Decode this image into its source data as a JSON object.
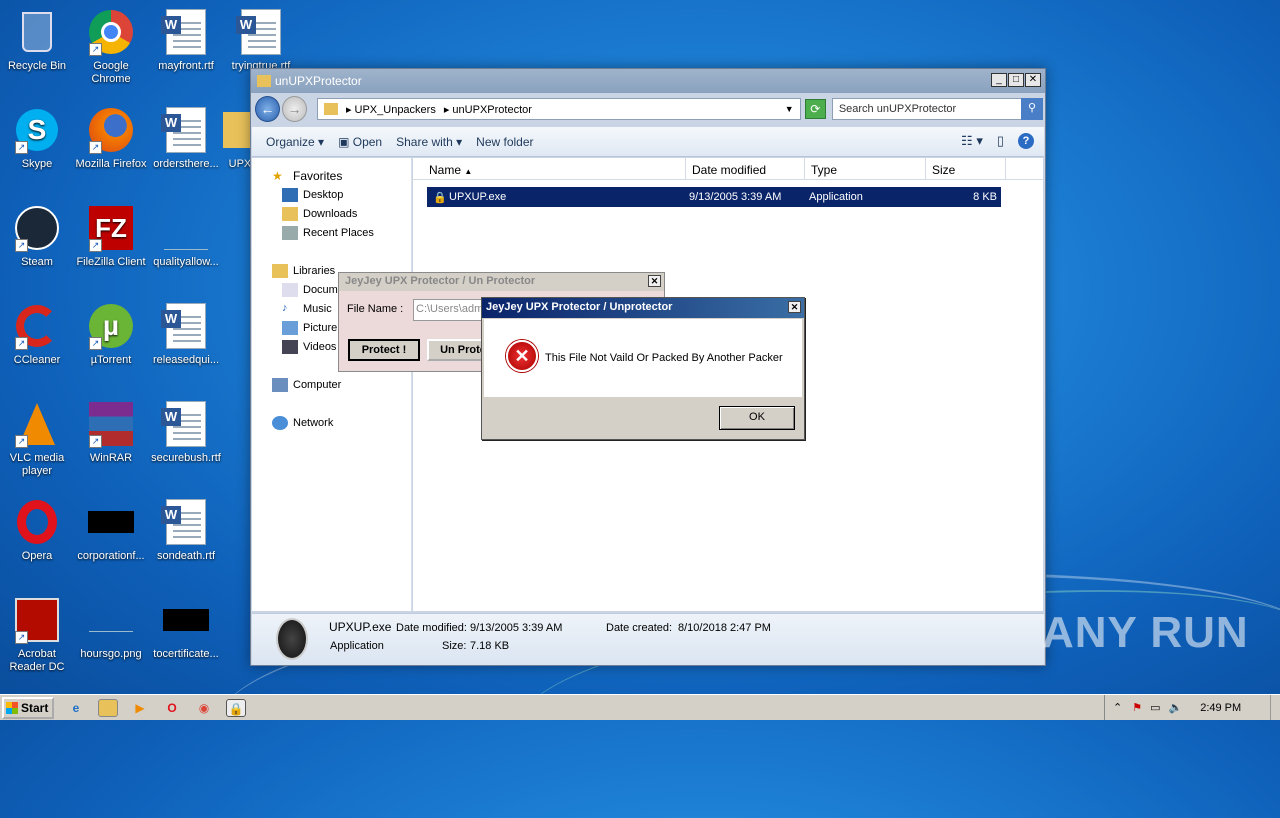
{
  "desktop": {
    "icons": [
      {
        "label": "Recycle Bin"
      },
      {
        "label": "Google Chrome"
      },
      {
        "label": "mayfront.rtf"
      },
      {
        "label": "tryingtrue.rtf"
      },
      {
        "label": "Skype"
      },
      {
        "label": "Mozilla Firefox"
      },
      {
        "label": "ordersthere..."
      },
      {
        "label": "UPX_"
      },
      {
        "label": "Steam"
      },
      {
        "label": "FileZilla Client"
      },
      {
        "label": "qualityallow..."
      },
      {
        "label": "CCleaner"
      },
      {
        "label": "µTorrent"
      },
      {
        "label": "releasedqui..."
      },
      {
        "label": "VLC media player"
      },
      {
        "label": "WinRAR"
      },
      {
        "label": "securebush.rtf"
      },
      {
        "label": "Opera"
      },
      {
        "label": "corporationf..."
      },
      {
        "label": "sondeath.rtf"
      },
      {
        "label": "Acrobat Reader DC"
      },
      {
        "label": "hoursgo.png"
      },
      {
        "label": "tocertificate..."
      }
    ]
  },
  "explorer": {
    "title": "unUPXProtector",
    "breadcrumb": [
      "UPX_Unpackers",
      "unUPXProtector"
    ],
    "search_placeholder": "Search unUPXProtector",
    "toolbar": {
      "organize": "Organize",
      "open": "Open",
      "share": "Share with",
      "new_folder": "New folder"
    },
    "nav": {
      "favorites": "Favorites",
      "desktop": "Desktop",
      "downloads": "Downloads",
      "recent": "Recent Places",
      "libraries": "Libraries",
      "documents": "Docum",
      "music": "Music",
      "pictures": "Picture",
      "videos": "Videos",
      "computer": "Computer",
      "network": "Network"
    },
    "columns": {
      "name": "Name",
      "date": "Date modified",
      "type": "Type",
      "size": "Size"
    },
    "file": {
      "name": "UPXUP.exe",
      "date": "9/13/2005 3:39 AM",
      "type": "Application",
      "size": "8 KB"
    },
    "details": {
      "name": "UPXUP.exe",
      "modified_label": "Date modified:",
      "modified": "9/13/2005 3:39 AM",
      "created_label": "Date created:",
      "created": "8/10/2018 2:47 PM",
      "type": "Application",
      "size_label": "Size:",
      "size": "7.18 KB"
    }
  },
  "protector": {
    "title": "JeyJey  UPX  Protector / Un Protector",
    "file_label": "File Name :",
    "file_value": "C:\\Users\\adm",
    "protect_button": "Protect !",
    "unprotect_button": "Un Prote"
  },
  "error_dialog": {
    "title": "JeyJey  UPX Protector / Unprotector",
    "message": "This File Not Vaild Or Packed By Another Packer",
    "ok": "OK"
  },
  "taskbar": {
    "start": "Start",
    "time": "2:49 PM"
  },
  "watermark": "ANY RUN"
}
